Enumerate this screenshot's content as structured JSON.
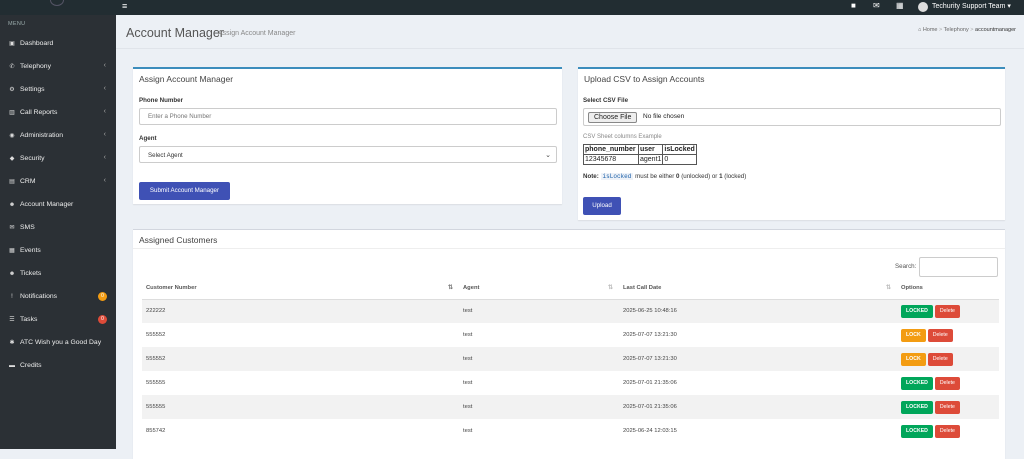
{
  "topbar": {
    "user_name": "Techurity Support Team",
    "toggle_glyph": "≡",
    "icons": [
      "puzzle-icon",
      "envelope-icon",
      "calendar-icon"
    ]
  },
  "sidebar": {
    "header": "MENU",
    "items": [
      {
        "name": "dashboard",
        "label": "Dashboard",
        "icon": "▣",
        "chevron": false
      },
      {
        "name": "telephony",
        "label": "Telephony",
        "icon": "✆",
        "chevron": true
      },
      {
        "name": "settings",
        "label": "Settings",
        "icon": "⚙",
        "chevron": true
      },
      {
        "name": "call-reports",
        "label": "Call Reports",
        "icon": "▥",
        "chevron": true
      },
      {
        "name": "administration",
        "label": "Administration",
        "icon": "◉",
        "chevron": true
      },
      {
        "name": "security",
        "label": "Security",
        "icon": "◆",
        "chevron": true
      },
      {
        "name": "crm",
        "label": "CRM",
        "icon": "▤",
        "chevron": true
      },
      {
        "name": "account-manager",
        "label": "Account Manager",
        "icon": "☻",
        "chevron": false
      },
      {
        "name": "sms",
        "label": "SMS",
        "icon": "✉",
        "chevron": false
      },
      {
        "name": "events",
        "label": "Events",
        "icon": "▦",
        "chevron": false
      },
      {
        "name": "tickets",
        "label": "Tickets",
        "icon": "☻",
        "chevron": false
      },
      {
        "name": "notifications",
        "label": "Notifications",
        "icon": "!",
        "chevron": false,
        "badge": "0",
        "badge_color": "#f39c12"
      },
      {
        "name": "tasks",
        "label": "Tasks",
        "icon": "☰",
        "chevron": false,
        "badge": "0",
        "badge_color": "#dd4b39"
      },
      {
        "name": "atc-greeting",
        "label": "ATC Wish you a Good Day",
        "icon": "✱",
        "chevron": false
      },
      {
        "name": "credits",
        "label": "Credits",
        "icon": "▬",
        "chevron": false
      }
    ]
  },
  "header": {
    "title": "Account Manager",
    "subtitle": "Assign Account Manager",
    "breadcrumb": [
      "Home",
      "Telephony",
      "accountmanager"
    ]
  },
  "assign_box": {
    "title": "Assign Account Manager",
    "phone_label": "Phone Number",
    "phone_placeholder": "Enter a Phone Number",
    "agent_label": "Agent",
    "agent_selected": "Select Agent",
    "submit_label": "Submit Account Manager"
  },
  "upload_box": {
    "title": "Upload CSV to Assign Accounts",
    "file_label": "Select CSV File",
    "choose_label": "Choose File",
    "no_file": "No file chosen",
    "example_caption": "CSV Sheet columns Example",
    "example_headers": [
      "phone_number",
      "user",
      "isLocked"
    ],
    "example_row": [
      "12345678",
      "agent1",
      "0"
    ],
    "note_prefix": "Note:",
    "note_code": "isLocked",
    "note_mid": "must be either",
    "note_v0": "0",
    "note_unlocked": "(unlocked) or",
    "note_v1": "1",
    "note_locked": "(locked)",
    "upload_label": "Upload"
  },
  "customers": {
    "title": "Assigned Customers",
    "search_label": "Search:",
    "columns": [
      "Customer Number",
      "Agent",
      "Last Call Date",
      "Options"
    ],
    "delete_label": "Delete",
    "rows": [
      {
        "number": "222222",
        "agent": "test",
        "date": "2025-06-25 10:48:16",
        "status": "LOCKED"
      },
      {
        "number": "555552",
        "agent": "test",
        "date": "2025-07-07 13:21:30",
        "status": "LOCK"
      },
      {
        "number": "555552",
        "agent": "test",
        "date": "2025-07-07 13:21:30",
        "status": "LOCK"
      },
      {
        "number": "555555",
        "agent": "test",
        "date": "2025-07-01 21:35:06",
        "status": "LOCKED"
      },
      {
        "number": "555555",
        "agent": "test",
        "date": "2025-07-01 21:35:06",
        "status": "LOCKED"
      },
      {
        "number": "855742",
        "agent": "test",
        "date": "2025-06-24 12:03:15",
        "status": "LOCKED"
      }
    ]
  },
  "colors": {
    "primary_button": "#3f51b5",
    "locked_green": "#00a65a",
    "lock_orange": "#f39c12",
    "delete_red": "#dd4b39",
    "sidebar_bg": "#2b3035",
    "topbar_bg": "#222d32"
  }
}
